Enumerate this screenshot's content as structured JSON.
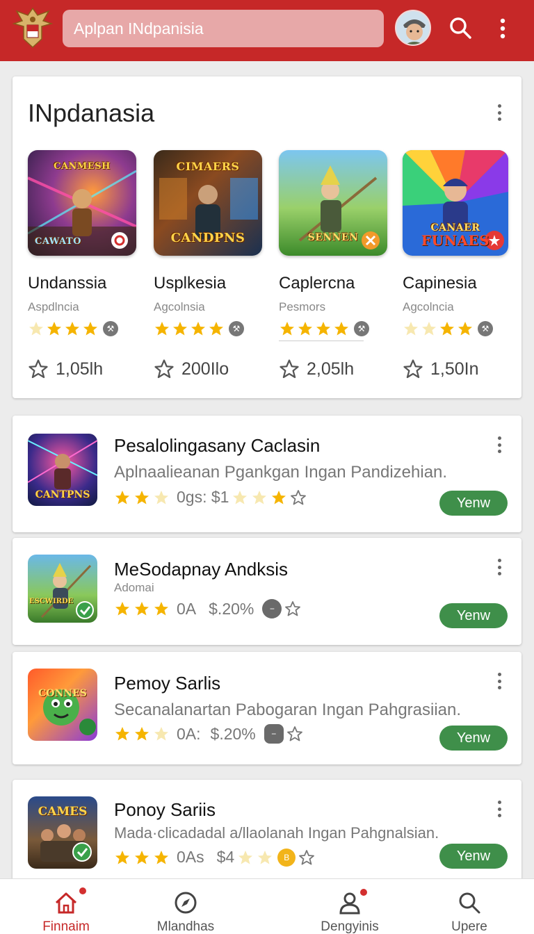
{
  "header": {
    "search_value": "Aplpan INdpanisia",
    "icons": {
      "logo": "garuda-emblem-icon",
      "avatar": "user-avatar",
      "search": "search-icon",
      "more": "more-vert-icon"
    },
    "color": "#c62828"
  },
  "featured": {
    "title": "INpdanasia",
    "games": [
      {
        "banner": "CANMESH",
        "banner2": "CAWATO",
        "name": "Undanssia",
        "sub": "Aspdlncia",
        "rating": 3,
        "count": "1,05lh"
      },
      {
        "banner": "CIMAERS",
        "banner2": "CANDPNS",
        "name": "Usplkesia",
        "sub": "Agcolnsia",
        "rating": 4,
        "count": "200Ilo"
      },
      {
        "banner": "SENNEN",
        "banner2": "",
        "name": "Caplercna",
        "sub": "Pesmors",
        "rating": 4,
        "count": "2,05lh"
      },
      {
        "banner": "CANAER",
        "banner2": "FUNAES",
        "name": "Capinesia",
        "sub": "Agcolncia",
        "rating": 2,
        "count": "1,50In"
      }
    ]
  },
  "list": [
    {
      "title": "Pesalolingasany Caclasin",
      "desc": "Aplnaalieanan Pgankgan Ingan Pandizehian.",
      "meta_a": "0gs: $1",
      "meta_b": "",
      "button": "Yenw",
      "thumb_text": "CANTPNS"
    },
    {
      "title": "MeSodapnay Andksis",
      "desc": "Adomai",
      "meta_a": "0A",
      "meta_b": "$.20%",
      "button": "Yenw",
      "thumb_text": "ESCWIRDE"
    },
    {
      "title": "Pemoy Sarlis",
      "desc": "Secanalanartan Pabogaran Ingan Pahgrasiian.",
      "meta_a": "0A:",
      "meta_b": "$.20%",
      "button": "Yenw",
      "thumb_text": "CONNES"
    },
    {
      "title": "Ponoy Sariis",
      "desc": "Mada·clicadadal a/llaolanah Ingan Pahgnalsian.",
      "meta_a": "0As",
      "meta_b": "$4",
      "button": "Yenw",
      "thumb_text": "CAMES"
    }
  ],
  "nav": [
    {
      "label": "Finnaim",
      "icon": "home-icon",
      "active": true
    },
    {
      "label": "Mlandhas",
      "icon": "compass-icon",
      "active": false
    },
    {
      "label": "Dengyinis",
      "icon": "person-icon",
      "active": false
    },
    {
      "label": "Upere",
      "icon": "search-icon",
      "active": false
    }
  ]
}
